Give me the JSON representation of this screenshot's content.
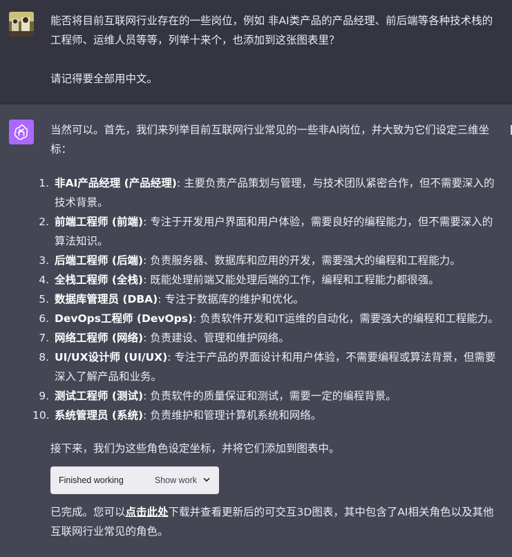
{
  "user_message": {
    "avatar": "user-photo-avatar",
    "paragraph_1": "能否将目前互联网行业存在的一些岗位，例如 非AI类产品的产品经理、前后端等各种技术栈的工程师、运维人员等等，列举十来个，也添加到这张图表里？",
    "paragraph_2": "请记得要全部用中文。"
  },
  "assistant_message": {
    "avatar": "chatgpt-logo-icon",
    "intro": "当然可以。首先，我们来列举目前互联网行业常见的一些非AI岗位，并大致为它们设定三维坐标：",
    "roles": [
      {
        "num": "1.",
        "title": "非AI产品经理 (产品经理)",
        "desc": ": 主要负责产品策划与管理，与技术团队紧密合作，但不需要深入的技术背景。"
      },
      {
        "num": "2.",
        "title": "前端工程师 (前端)",
        "desc": ": 专注于开发用户界面和用户体验，需要良好的编程能力，但不需要深入的算法知识。"
      },
      {
        "num": "3.",
        "title": "后端工程师 (后端)",
        "desc": ": 负责服务器、数据库和应用的开发，需要强大的编程和工程能力。"
      },
      {
        "num": "4.",
        "title": "全栈工程师 (全栈)",
        "desc": ": 既能处理前端又能处理后端的工作，编程和工程能力都很强。"
      },
      {
        "num": "5.",
        "title": "数据库管理员 (DBA)",
        "desc": ": 专注于数据库的维护和优化。"
      },
      {
        "num": "6.",
        "title": "DevOps工程师 (DevOps)",
        "desc": ": 负责软件开发和IT运维的自动化，需要强大的编程和工程能力。"
      },
      {
        "num": "7.",
        "title": "网络工程师 (网络)",
        "desc": ": 负责建设、管理和维护网络。"
      },
      {
        "num": "8.",
        "title": "UI/UX设计师 (UI/UX)",
        "desc": ": 专注于产品的界面设计和用户体验，不需要编程或算法背景，但需要深入了解产品和业务。"
      },
      {
        "num": "9.",
        "title": "测试工程师 (测试)",
        "desc": ": 负责软件的质量保证和测试，需要一定的编程背景。"
      },
      {
        "num": "10.",
        "title": "系统管理员 (系统)",
        "desc": ": 负责维护和管理计算机系统和网络。"
      }
    ],
    "followup": "接下来，我们为这些角色设定坐标，并将它们添加到图表中。",
    "work_box": {
      "status": "Finished working",
      "toggle_label": "Show work",
      "toggle_icon": "chevron-down-icon"
    },
    "final": {
      "before_link": "已完成。您可以",
      "link_text": "点击此处",
      "after_link": "下载并查看更新后的可交互3D图表，其中包含了AI相关角色以及其他互联网行业常见的角色。"
    }
  },
  "colors": {
    "user_bg": "#343541",
    "assistant_bg": "#444654",
    "bot_avatar_bg": "#ab68ff",
    "text": "#ececf1",
    "work_box_bg": "#ececf1"
  }
}
